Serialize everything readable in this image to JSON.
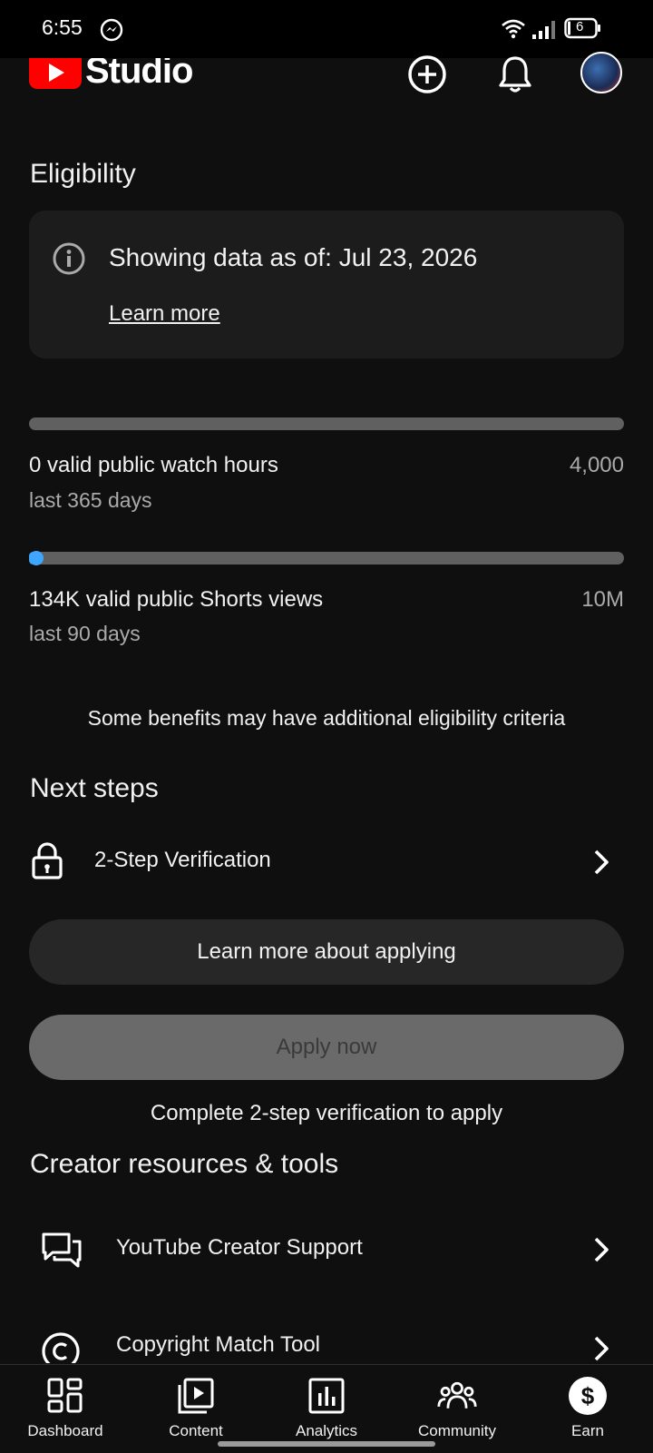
{
  "status_bar": {
    "time": "6:55",
    "battery": "6"
  },
  "header": {
    "app_name": "Studio"
  },
  "eligibility": {
    "title": "Eligibility",
    "info_text": "Showing data as of: Jul 23, 2026",
    "learn_more": "Learn more",
    "metrics": [
      {
        "label": "0 valid public watch hours",
        "period": "last 365 days",
        "target": "4,000",
        "progress": 0.0
      },
      {
        "label": "134K valid public Shorts views",
        "period": "last 90 days",
        "target": "10M",
        "progress": 0.0134
      }
    ],
    "benefits_note": "Some benefits may have additional eligibility criteria"
  },
  "next_steps": {
    "title": "Next steps",
    "items": [
      {
        "label": "2-Step Verification",
        "icon": "lock-icon"
      }
    ],
    "learn_more_button": "Learn more about applying",
    "apply_button": "Apply now",
    "apply_note": "Complete 2-step verification to apply"
  },
  "resources": {
    "title": "Creator resources & tools",
    "items": [
      {
        "label": "YouTube Creator Support",
        "icon": "chat-icon"
      },
      {
        "label": "Copyright Match Tool",
        "icon": "copyright-icon"
      }
    ]
  },
  "bottom_nav": {
    "items": [
      {
        "label": "Dashboard",
        "icon": "dashboard-icon"
      },
      {
        "label": "Content",
        "icon": "content-icon"
      },
      {
        "label": "Analytics",
        "icon": "analytics-icon"
      },
      {
        "label": "Community",
        "icon": "community-icon"
      },
      {
        "label": "Earn",
        "icon": "earn-icon",
        "active": true
      }
    ]
  },
  "colors": {
    "background": "#0f0f0f",
    "accent": "#3ea6ff",
    "brand": "#ff0000"
  }
}
